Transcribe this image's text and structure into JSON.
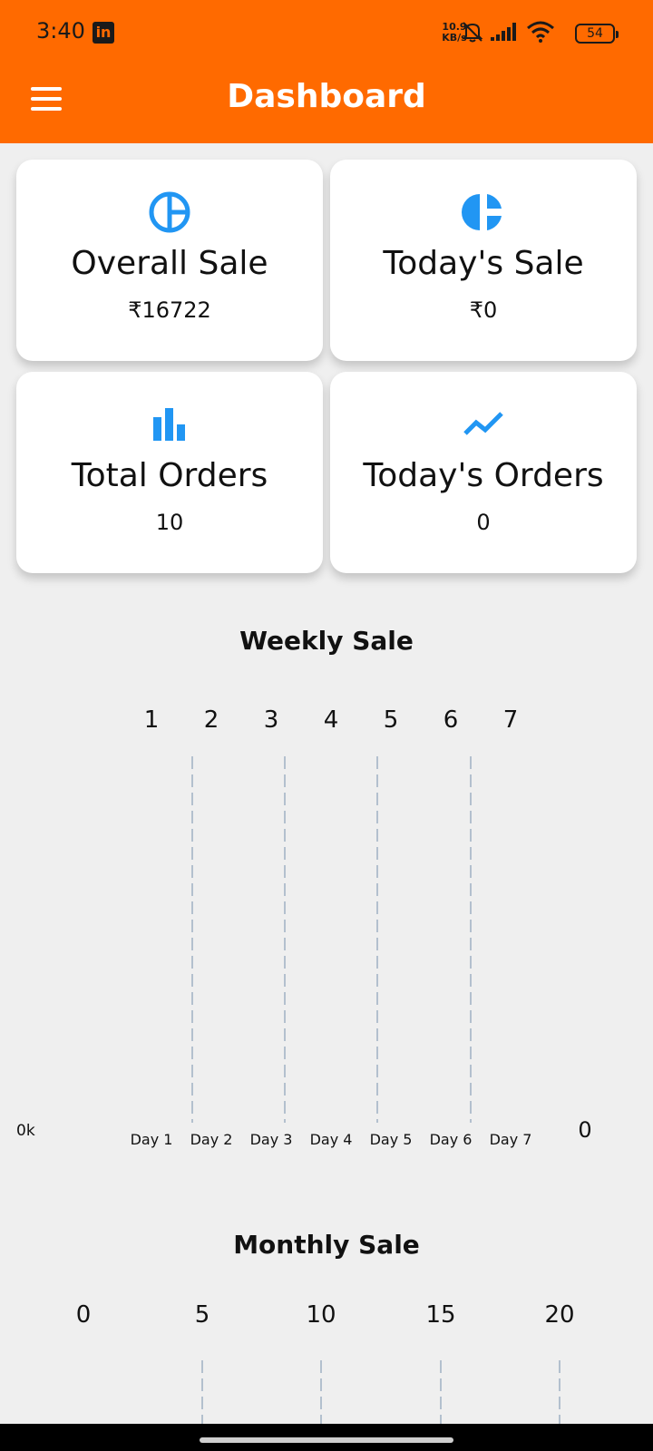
{
  "status_bar": {
    "time": "3:40",
    "net_speed_value": "10.9",
    "net_speed_unit": "KB/s",
    "battery": "54",
    "notification_icon": "linkedin-icon"
  },
  "app_bar": {
    "title": "Dashboard",
    "menu_icon": "hamburger-menu-icon"
  },
  "cards": [
    {
      "title": "Overall Sale",
      "value": "₹16722",
      "icon": "pie-chart-outline-icon",
      "icon_color": "#2196f3"
    },
    {
      "title": "Today's Sale",
      "value": "₹0",
      "icon": "pie-chart-filled-icon",
      "icon_color": "#2196f3"
    },
    {
      "title": "Total Orders",
      "value": "10",
      "icon": "bar-chart-icon",
      "icon_color": "#2196f3"
    },
    {
      "title": "Today's Orders",
      "value": "0",
      "icon": "trend-line-icon",
      "icon_color": "#2196f3"
    }
  ],
  "weekly": {
    "title": "Weekly Sale",
    "top_labels": [
      "1",
      "2",
      "3",
      "4",
      "5",
      "6",
      "7"
    ],
    "bottom_labels": [
      "Day 1",
      "Day 2",
      "Day 3",
      "Day 4",
      "Day 5",
      "Day 6",
      "Day 7"
    ],
    "y_left_label": "0k",
    "y_right_label": "0"
  },
  "monthly": {
    "title": "Monthly Sale",
    "top_labels": [
      "0",
      "5",
      "10",
      "15",
      "20"
    ]
  },
  "chart_data": [
    {
      "type": "bar",
      "title": "Weekly Sale",
      "categories": [
        "Day 1",
        "Day 2",
        "Day 3",
        "Day 4",
        "Day 5",
        "Day 6",
        "Day 7"
      ],
      "values": [
        0,
        0,
        0,
        0,
        0,
        0,
        0
      ],
      "grid": true
    },
    {
      "type": "bar",
      "title": "Monthly Sale",
      "x_ticks": [
        0,
        5,
        10,
        15,
        20
      ],
      "grid": true
    }
  ],
  "colors": {
    "accent": "#ff6a00",
    "icon_blue": "#2196f3",
    "background": "#efefef"
  }
}
